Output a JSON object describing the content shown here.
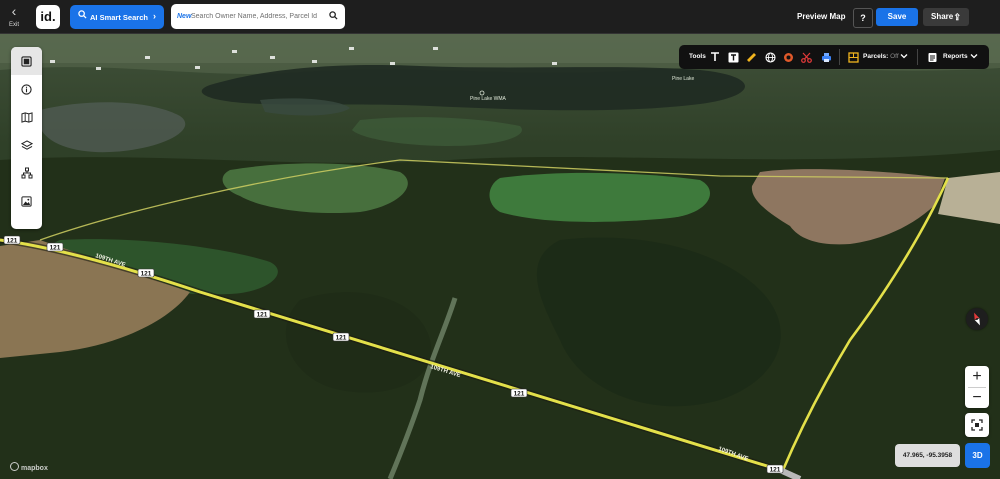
{
  "topbar": {
    "exit_label": "Exit",
    "logo_text": "id.",
    "ai_search_label": "AI Smart Search",
    "search_new_badge": "New",
    "search_placeholder": "Search Owner Name, Address, Parcel Id",
    "preview_label": "Preview Map",
    "help_label": "?",
    "save_label": "Save",
    "share_label": "Share"
  },
  "left_toolbar": [
    {
      "icon": "panel-icon"
    },
    {
      "icon": "info-icon"
    },
    {
      "icon": "map-icon"
    },
    {
      "icon": "layers-icon"
    },
    {
      "icon": "hierarchy-icon"
    },
    {
      "icon": "image-icon"
    }
  ],
  "tools_bar": {
    "tools_label": "Tools",
    "tools": [
      "text-icon",
      "text-box-icon",
      "ruler-icon",
      "globe-icon",
      "circle-icon",
      "scissors-icon",
      "print-icon"
    ],
    "parcels_label": "Parcels:",
    "parcels_state": "Off",
    "reports_label": "Reports"
  },
  "map": {
    "road_shields": [
      "121",
      "121",
      "121",
      "121",
      "121",
      "121",
      "121"
    ],
    "road_names": [
      "109TH AVE",
      "109TH AVE",
      "109TH AVE"
    ],
    "place_labels": [
      "Pine Lake",
      "Pine Lake WMA"
    ],
    "attribution": "mapbox"
  },
  "controls": {
    "zoom_in": "+",
    "zoom_out": "−",
    "coordinates": "47.965, -95.3958",
    "mode_3d": "3D"
  },
  "colors": {
    "accent": "#1a73e8",
    "road": "#e3e04a",
    "topbar": "#1e1e1e"
  }
}
